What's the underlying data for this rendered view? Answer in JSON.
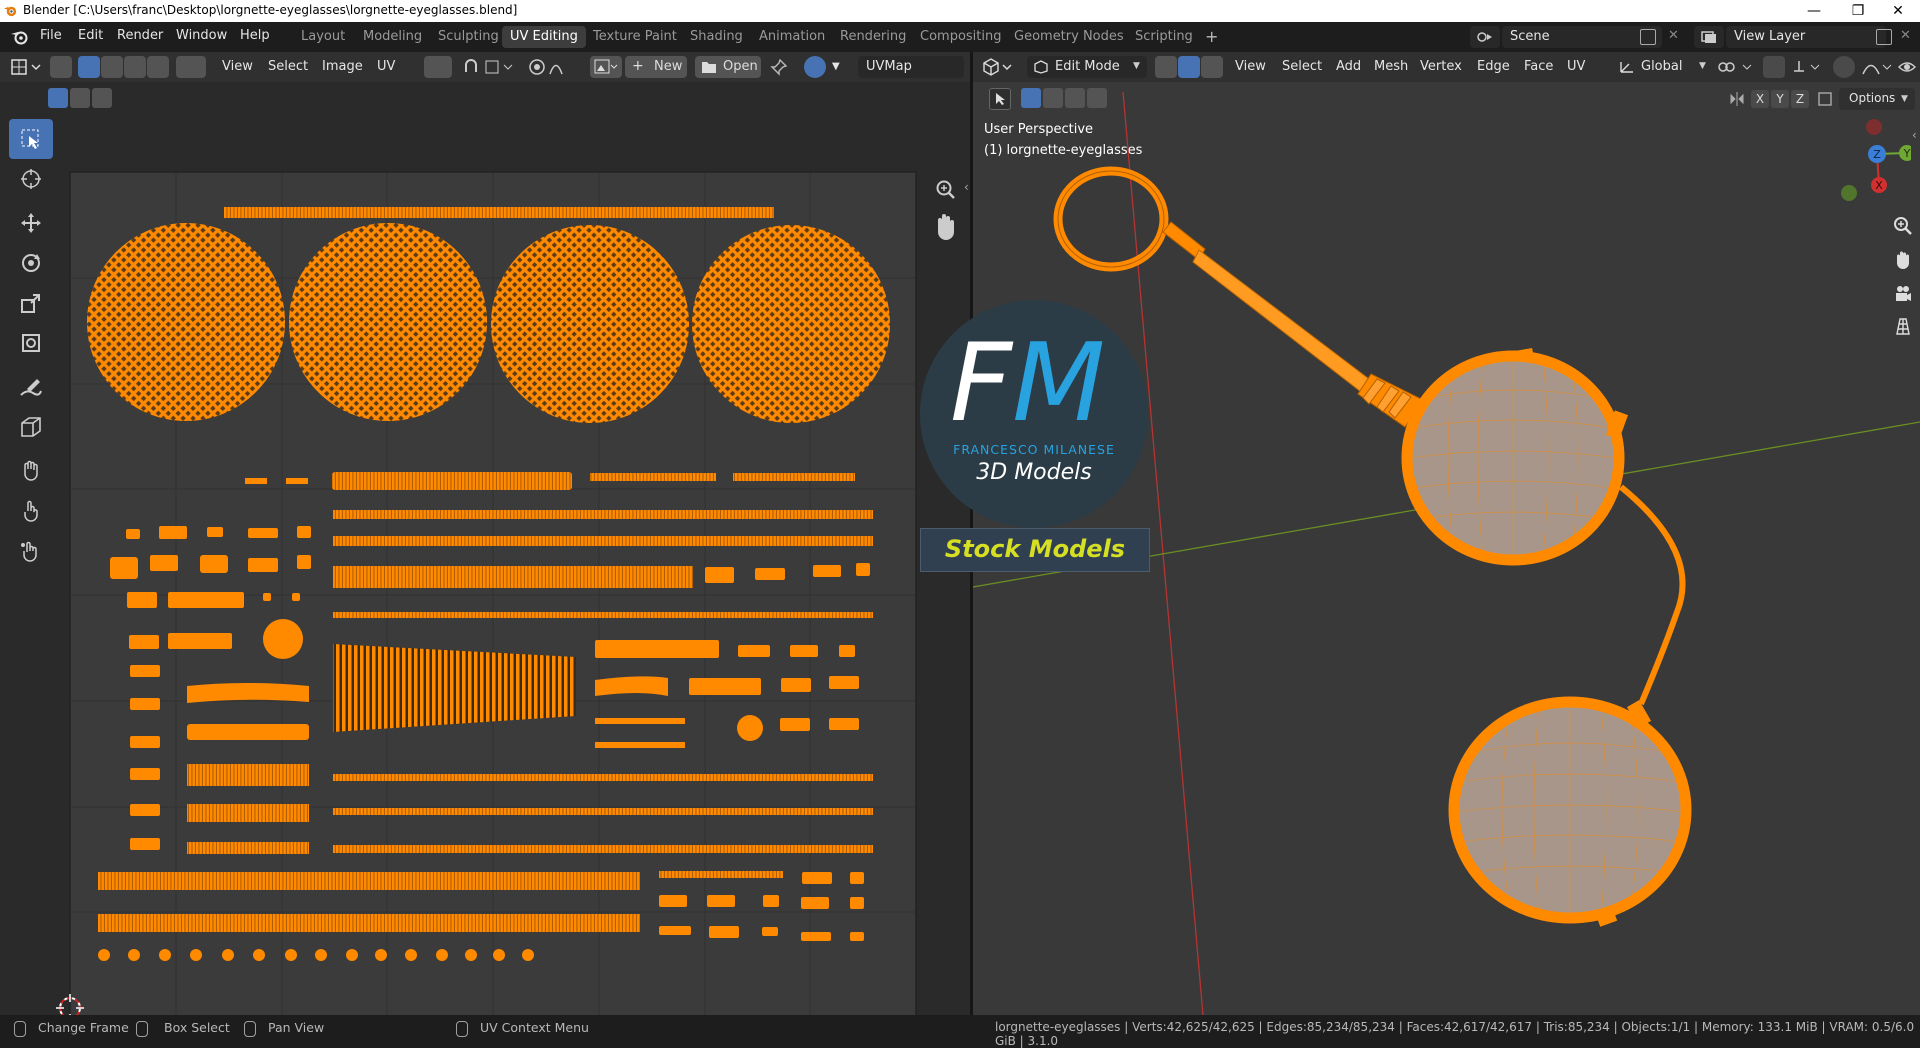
{
  "window": {
    "title": "Blender [C:\\Users\\franc\\Desktop\\lorgnette-eyeglasses\\lorgnette-eyeglasses.blend]",
    "minimize": "—",
    "maximize": "❐",
    "close": "✕"
  },
  "menubar": {
    "items": [
      "File",
      "Edit",
      "Render",
      "Window",
      "Help"
    ]
  },
  "workspaces": [
    "Layout",
    "Modeling",
    "Sculpting",
    "UV Editing",
    "Texture Paint",
    "Shading",
    "Animation",
    "Rendering",
    "Compositing",
    "Geometry Nodes",
    "Scripting"
  ],
  "workspace_active": "UV Editing",
  "add_workspace": "+",
  "scene": {
    "label": "Scene"
  },
  "view_layer": {
    "label": "View Layer"
  },
  "uv_editor": {
    "menus": [
      "View",
      "Select",
      "Image",
      "UV"
    ],
    "new_label": "New",
    "open_label": "Open",
    "uvmap": "UVMap"
  },
  "view3d": {
    "mode": "Edit Mode",
    "menus": [
      "View",
      "Select",
      "Add",
      "Mesh",
      "Vertex",
      "Edge",
      "Face",
      "UV"
    ],
    "orientation": "Global",
    "options_label": "Options",
    "axes": [
      "X",
      "Y",
      "Z"
    ],
    "overlay_line1": "User Perspective",
    "overlay_line2": "(1) lorgnette-eyeglasses",
    "gizmo": {
      "z": "Z",
      "y": "Y",
      "x": "X"
    }
  },
  "watermark": {
    "fm": "FM",
    "name": "FRANCESCO MILANESE",
    "tagline": "3D Models",
    "band": "Stock Models"
  },
  "statusbar": {
    "items": [
      "Change Frame",
      "Box Select",
      "Pan View",
      "UV Context Menu"
    ],
    "stats": "lorgnette-eyeglasses | Verts:42,625/42,625 | Edges:85,234/85,234 | Faces:42,617/42,617 | Tris:85,234 | Objects:1/1 | Memory: 133.1 MiB | VRAM: 0.5/6.0 GiB | 3.1.0"
  },
  "colors": {
    "uv_orange": "#ff8a00",
    "accent_blue": "#4772b3",
    "viewport_bg": "#393939",
    "fm_blue": "#28a3e0",
    "band_yellow": "#d7df23"
  }
}
